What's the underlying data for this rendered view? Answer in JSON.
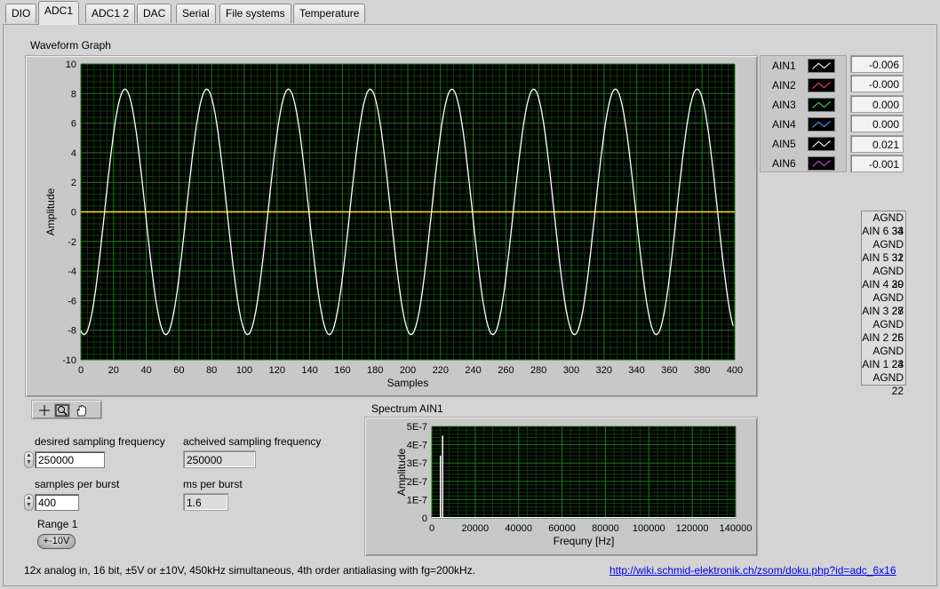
{
  "tabs": [
    "DIO",
    "ADC1",
    "ADC1 2",
    "DAC",
    "Serial",
    "File systems",
    "Temperature"
  ],
  "active_tab": "ADC1",
  "waveform_graph": {
    "title": "Waveform Graph",
    "xlabel": "Samples",
    "ylabel": "Amplitude"
  },
  "legend": [
    {
      "name": "AIN1",
      "color": "#ffffff",
      "value": "-0.006"
    },
    {
      "name": "AIN2",
      "color": "#ff4080",
      "value": "-0.000"
    },
    {
      "name": "AIN3",
      "color": "#40e040",
      "value": "0.000"
    },
    {
      "name": "AIN4",
      "color": "#40a0ff",
      "value": "0.000"
    },
    {
      "name": "AIN5",
      "color": "#ffffff",
      "value": "0.021"
    },
    {
      "name": "AIN6",
      "color": "#e040ff",
      "value": "-0.001"
    }
  ],
  "pins": [
    "AGND 34",
    "AIN 6 33",
    "AGND 32",
    "AIN 5 31",
    "AGND 30",
    "AIN 4 29",
    "AGND 28",
    "AIN 3 27",
    "AGND 26",
    "AIN 2 25",
    "AGND 24",
    "AIN 1 23",
    "AGND 22"
  ],
  "tools": [
    "cursor-icon",
    "zoom-icon",
    "pan-hand-icon"
  ],
  "controls": {
    "desired_label": "desired sampling frequency",
    "desired_value": "250000",
    "achieved_label": "acheived sampling frequency",
    "achieved_value": "250000",
    "samples_label": "samples per burst",
    "samples_value": "400",
    "ms_label": "ms per burst",
    "ms_value": "1.6",
    "range_label": "Range 1",
    "range_value": "+-10V"
  },
  "spectrum": {
    "title": "Spectrum AIN1",
    "xlabel": "Frequny [Hz]",
    "ylabel": "Amplitude"
  },
  "footer": {
    "description": "12x analog in, 16 bit, ±5V or ±10V, 450kHz simultaneous, 4th order antialiasing with fg=200kHz.",
    "link": "http://wiki.schmid-elektronik.ch/zsom/doku.php?id=adc_6x16"
  },
  "chart_data": [
    {
      "type": "line",
      "title": "Waveform Graph",
      "xlabel": "Samples",
      "ylabel": "Amplitude",
      "xlim": [
        0,
        400
      ],
      "ylim": [
        -10,
        10
      ],
      "x_ticks": [
        0,
        20,
        40,
        60,
        80,
        100,
        120,
        140,
        160,
        180,
        200,
        220,
        240,
        260,
        280,
        300,
        320,
        340,
        360,
        380,
        400
      ],
      "y_ticks": [
        10,
        8,
        6,
        4,
        2,
        0,
        -2,
        -4,
        -6,
        -8,
        -10
      ],
      "grid": true,
      "series": [
        {
          "name": "AIN1",
          "color": "#ffffff",
          "shape": "sine",
          "amplitude": 8.3,
          "period_samples": 50,
          "phase_samples": 27,
          "n_samples": 400
        },
        {
          "name": "AIN2",
          "color": "#ff4080",
          "constant": 0
        },
        {
          "name": "AIN3",
          "color": "#e0e000",
          "constant": 0
        }
      ]
    },
    {
      "type": "bar",
      "title": "Spectrum AIN1",
      "xlabel": "Frequny [Hz]",
      "ylabel": "Amplitude",
      "xlim": [
        0,
        140000
      ],
      "ylim": [
        0,
        5e-07
      ],
      "x_ticks": [
        0,
        20000,
        40000,
        60000,
        80000,
        100000,
        120000,
        140000
      ],
      "y_ticks": [
        "5E-7",
        "4E-7",
        "3E-7",
        "2E-7",
        "1E-7",
        "0"
      ],
      "grid": true,
      "peaks": [
        {
          "x": 4000,
          "y": 3.4e-07
        },
        {
          "x": 5000,
          "y": 4.5e-07
        }
      ]
    }
  ]
}
